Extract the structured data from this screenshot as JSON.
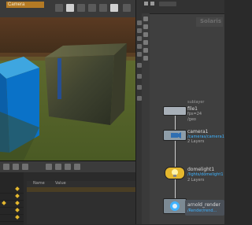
{
  "viewport": {
    "camera_tab": "Camera",
    "param_header": {
      "name": "Name",
      "value": "Value"
    }
  },
  "network": {
    "label": "Solaris",
    "nodes": [
      {
        "name": "sublayer",
        "sub": ""
      },
      {
        "name": "file1",
        "sub": "fps=24"
      },
      {
        "name": "",
        "sub": "/geo"
      },
      {
        "name": "camera1",
        "sub": "/cameras/camera1"
      },
      {
        "name": "",
        "sub": "2 Layers"
      },
      {
        "name": "domelight1",
        "sub": "/lights/domelight1"
      },
      {
        "name": "",
        "sub": "2 Layers"
      },
      {
        "name": "arnold_render",
        "sub": "/Render/rend..."
      }
    ]
  },
  "colors": {
    "camera_tab": "#b47a24",
    "selected_node": "#3fb3ff",
    "light_node": "#e5b82e",
    "timeline_key": "#e5b82e"
  }
}
